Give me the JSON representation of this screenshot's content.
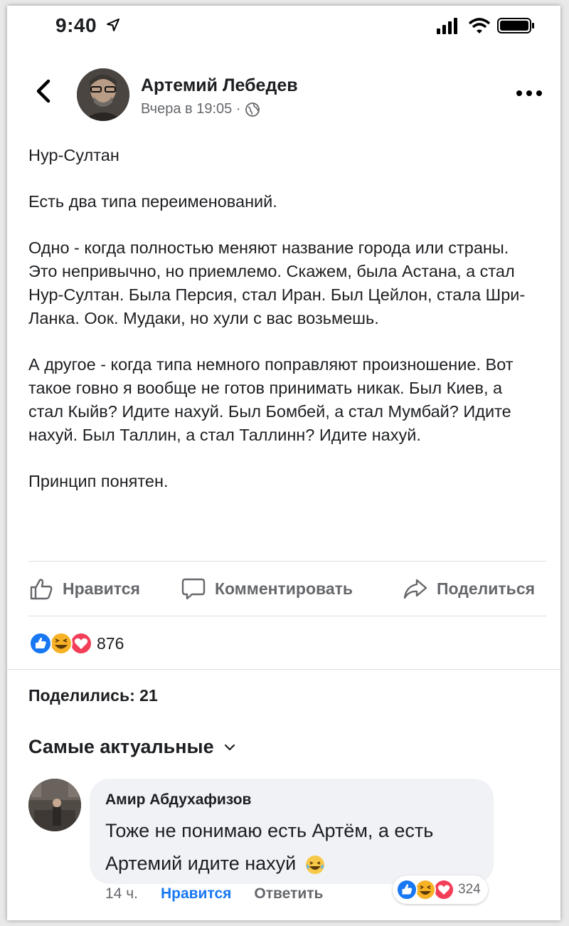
{
  "status_bar": {
    "time": "9:40"
  },
  "post": {
    "author": "Артемий Лебедев",
    "time": "Вчера в 19:05 ·",
    "paragraphs": [
      "Нур-Султан",
      "Есть два типа переименований.",
      "Одно - когда полностью меняют название города или страны. Это непривычно, но приемлемо. Скажем, была Астана, а стал Нур-Султан. Была Персия, стал Иран. Был Цейлон, стала Шри-Ланка. Оок. Мудаки, но хули с вас возьмешь.",
      "А другое - когда типа немного поправляют произношение. Вот такое говно я вообще не готов принимать никак. Был Киев, а стал Кыйв? Идите нахуй. Был Бомбей, а стал Мумбай? Идите нахуй. Был Таллин, а стал Таллинн? Идите нахуй.",
      "Принцип понятен."
    ]
  },
  "actions": {
    "like": "Нравится",
    "comment": "Комментировать",
    "share": "Поделиться"
  },
  "reactions": {
    "count": "876"
  },
  "shares": {
    "label": "Поделились: 21"
  },
  "sort": {
    "label": "Самые актуальные"
  },
  "comment": {
    "author": "Амир Абдухафизов",
    "text": "Тоже не понимаю есть Артём, а есть Артемий идите нахуй",
    "time": "14 ч.",
    "like": "Нравится",
    "reply": "Ответить",
    "reaction_count": "324"
  },
  "colors": {
    "like_blue": "#1877f2",
    "love_red": "#f33e58",
    "haha_yellow": "#f7b125",
    "muted": "#65676b"
  },
  "icons": [
    "location-arrow-icon",
    "signal-icon",
    "wifi-icon",
    "battery-icon",
    "back-chevron-icon",
    "globe-icon",
    "more-dots-icon",
    "thumbs-up-icon",
    "comment-icon",
    "share-icon",
    "like-reaction-icon",
    "haha-reaction-icon",
    "love-reaction-icon",
    "chevron-down-icon",
    "laughing-emoji-icon"
  ]
}
